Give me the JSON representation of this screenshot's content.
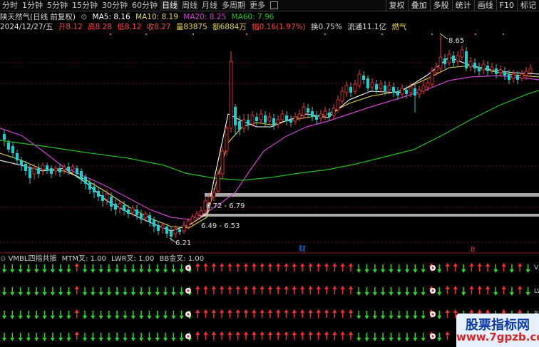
{
  "toolbar": {
    "timeframes": [
      "分时",
      "1分钟",
      "5分钟",
      "15分钟",
      "30分钟",
      "60分钟",
      "日线",
      "周线",
      "月线",
      "多周期",
      "更多"
    ],
    "active_index": 6,
    "right_tools": [
      "复权",
      "叠加",
      "多股",
      "统计",
      "画线",
      "F10",
      "标记"
    ]
  },
  "info": {
    "stock_name": "陕天然气(日线 前复权)",
    "ma5": "MA5: 8.16",
    "ma10": "MA10: 8.19",
    "ma20": "MA20: 8.25",
    "ma60": "MA60: 7.96",
    "date": "2024/12/27/五",
    "open": "开8.12",
    "high": "高8.28",
    "low": "低8.12",
    "close": "收8.27",
    "volume": "量83875",
    "amount": "额6884万",
    "change": "幅0.16(1.97%)",
    "turnover": "换0.75%",
    "float_cap": "流通11.1亿",
    "sector": "燃气"
  },
  "annotations": {
    "peak_label": "8.65",
    "low_label": "6.21",
    "range1": "6.72 - 6.79",
    "range2": "6.49 - 6.53",
    "marker_cai": "财",
    "marker_b": "B"
  },
  "indicator": {
    "title": "VMBL四指共振",
    "mtm": "MTM叉: 1.00",
    "lwr": "LWR叉: 1.00",
    "bb": "BB金叉: 1.00",
    "edge_labels": [
      "VM",
      "LW",
      "BB"
    ]
  },
  "colors": {
    "up": "#ff3b3b",
    "down": "#18d0d0",
    "ma5": "#ffffff",
    "ma10": "#e8d44a",
    "ma20": "#d040d0",
    "ma60": "#20c020",
    "arrow_up": "#ff2a2a",
    "arrow_down": "#22dd22"
  },
  "watermark": {
    "title": "股票指标网",
    "url": "www.7gpzb.com"
  }
}
